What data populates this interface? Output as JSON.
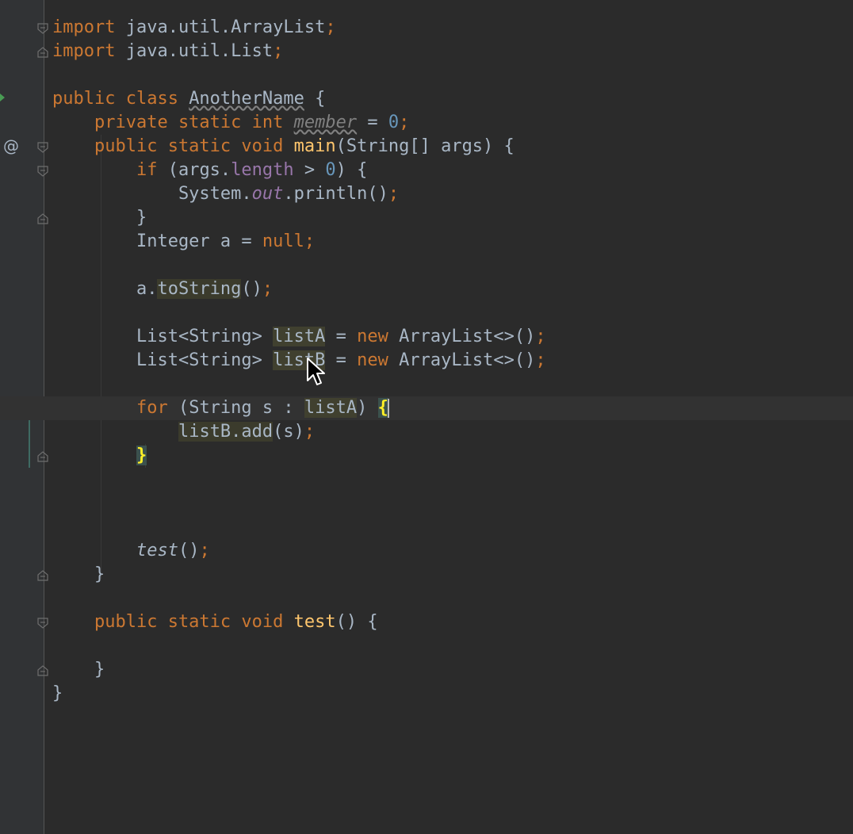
{
  "gutter": {
    "at_marker": "@"
  },
  "code": {
    "l1": {
      "kw": "import",
      "text": " java.util.ArrayList",
      "semi": ";"
    },
    "l2": {
      "kw": "import",
      "text": " java.util.List",
      "semi": ";"
    },
    "l4": {
      "kw": "public class ",
      "name": "AnotherName",
      "rest": " {"
    },
    "l5": {
      "kw": "    private static int ",
      "field": "member",
      "eq": " = ",
      "num": "0",
      "semi": ";"
    },
    "l6": {
      "kw": "    public static void ",
      "fn": "main",
      "rest": "(String[] args) {"
    },
    "l7": {
      "kw": "        if ",
      "a": "(args.",
      "field": "length",
      "b": " > ",
      "num": "0",
      "c": ") {"
    },
    "l8": {
      "a": "            System.",
      "static": "out",
      "b": ".println()",
      "semi": ";"
    },
    "l9": {
      "text": "        }"
    },
    "l10": {
      "a": "        Integer a = ",
      "kw": "null",
      "semi": ";"
    },
    "l12": {
      "a": "        a.",
      "hl": "toString",
      "b": "()",
      "semi": ";"
    },
    "l14": {
      "a": "        List<String> ",
      "var": "listA",
      "b": " = ",
      "kw": "new",
      "c": " ArrayList<>()",
      "semi": ";"
    },
    "l15": {
      "a": "        List<String> ",
      "var": "listB",
      "b": " = ",
      "kw": "new",
      "c": " ArrayList<>()",
      "semi": ";"
    },
    "l17": {
      "kw": "        for",
      "a": " (String s : ",
      "var": "listA",
      "b": ") ",
      "brace": "{"
    },
    "l18": {
      "a": "            ",
      "hl": "listB.add",
      "b": "(s)",
      "semi": ";"
    },
    "l19": {
      "a": "        ",
      "brace": "}"
    },
    "l23": {
      "a": "        ",
      "italic": "test",
      "b": "()",
      "semi": ";"
    },
    "l24": {
      "text": "    }"
    },
    "l26": {
      "kw": "    public static void ",
      "fn": "test",
      "rest": "() {"
    },
    "l28": {
      "text": "    }"
    },
    "l29": {
      "text": "}"
    }
  }
}
